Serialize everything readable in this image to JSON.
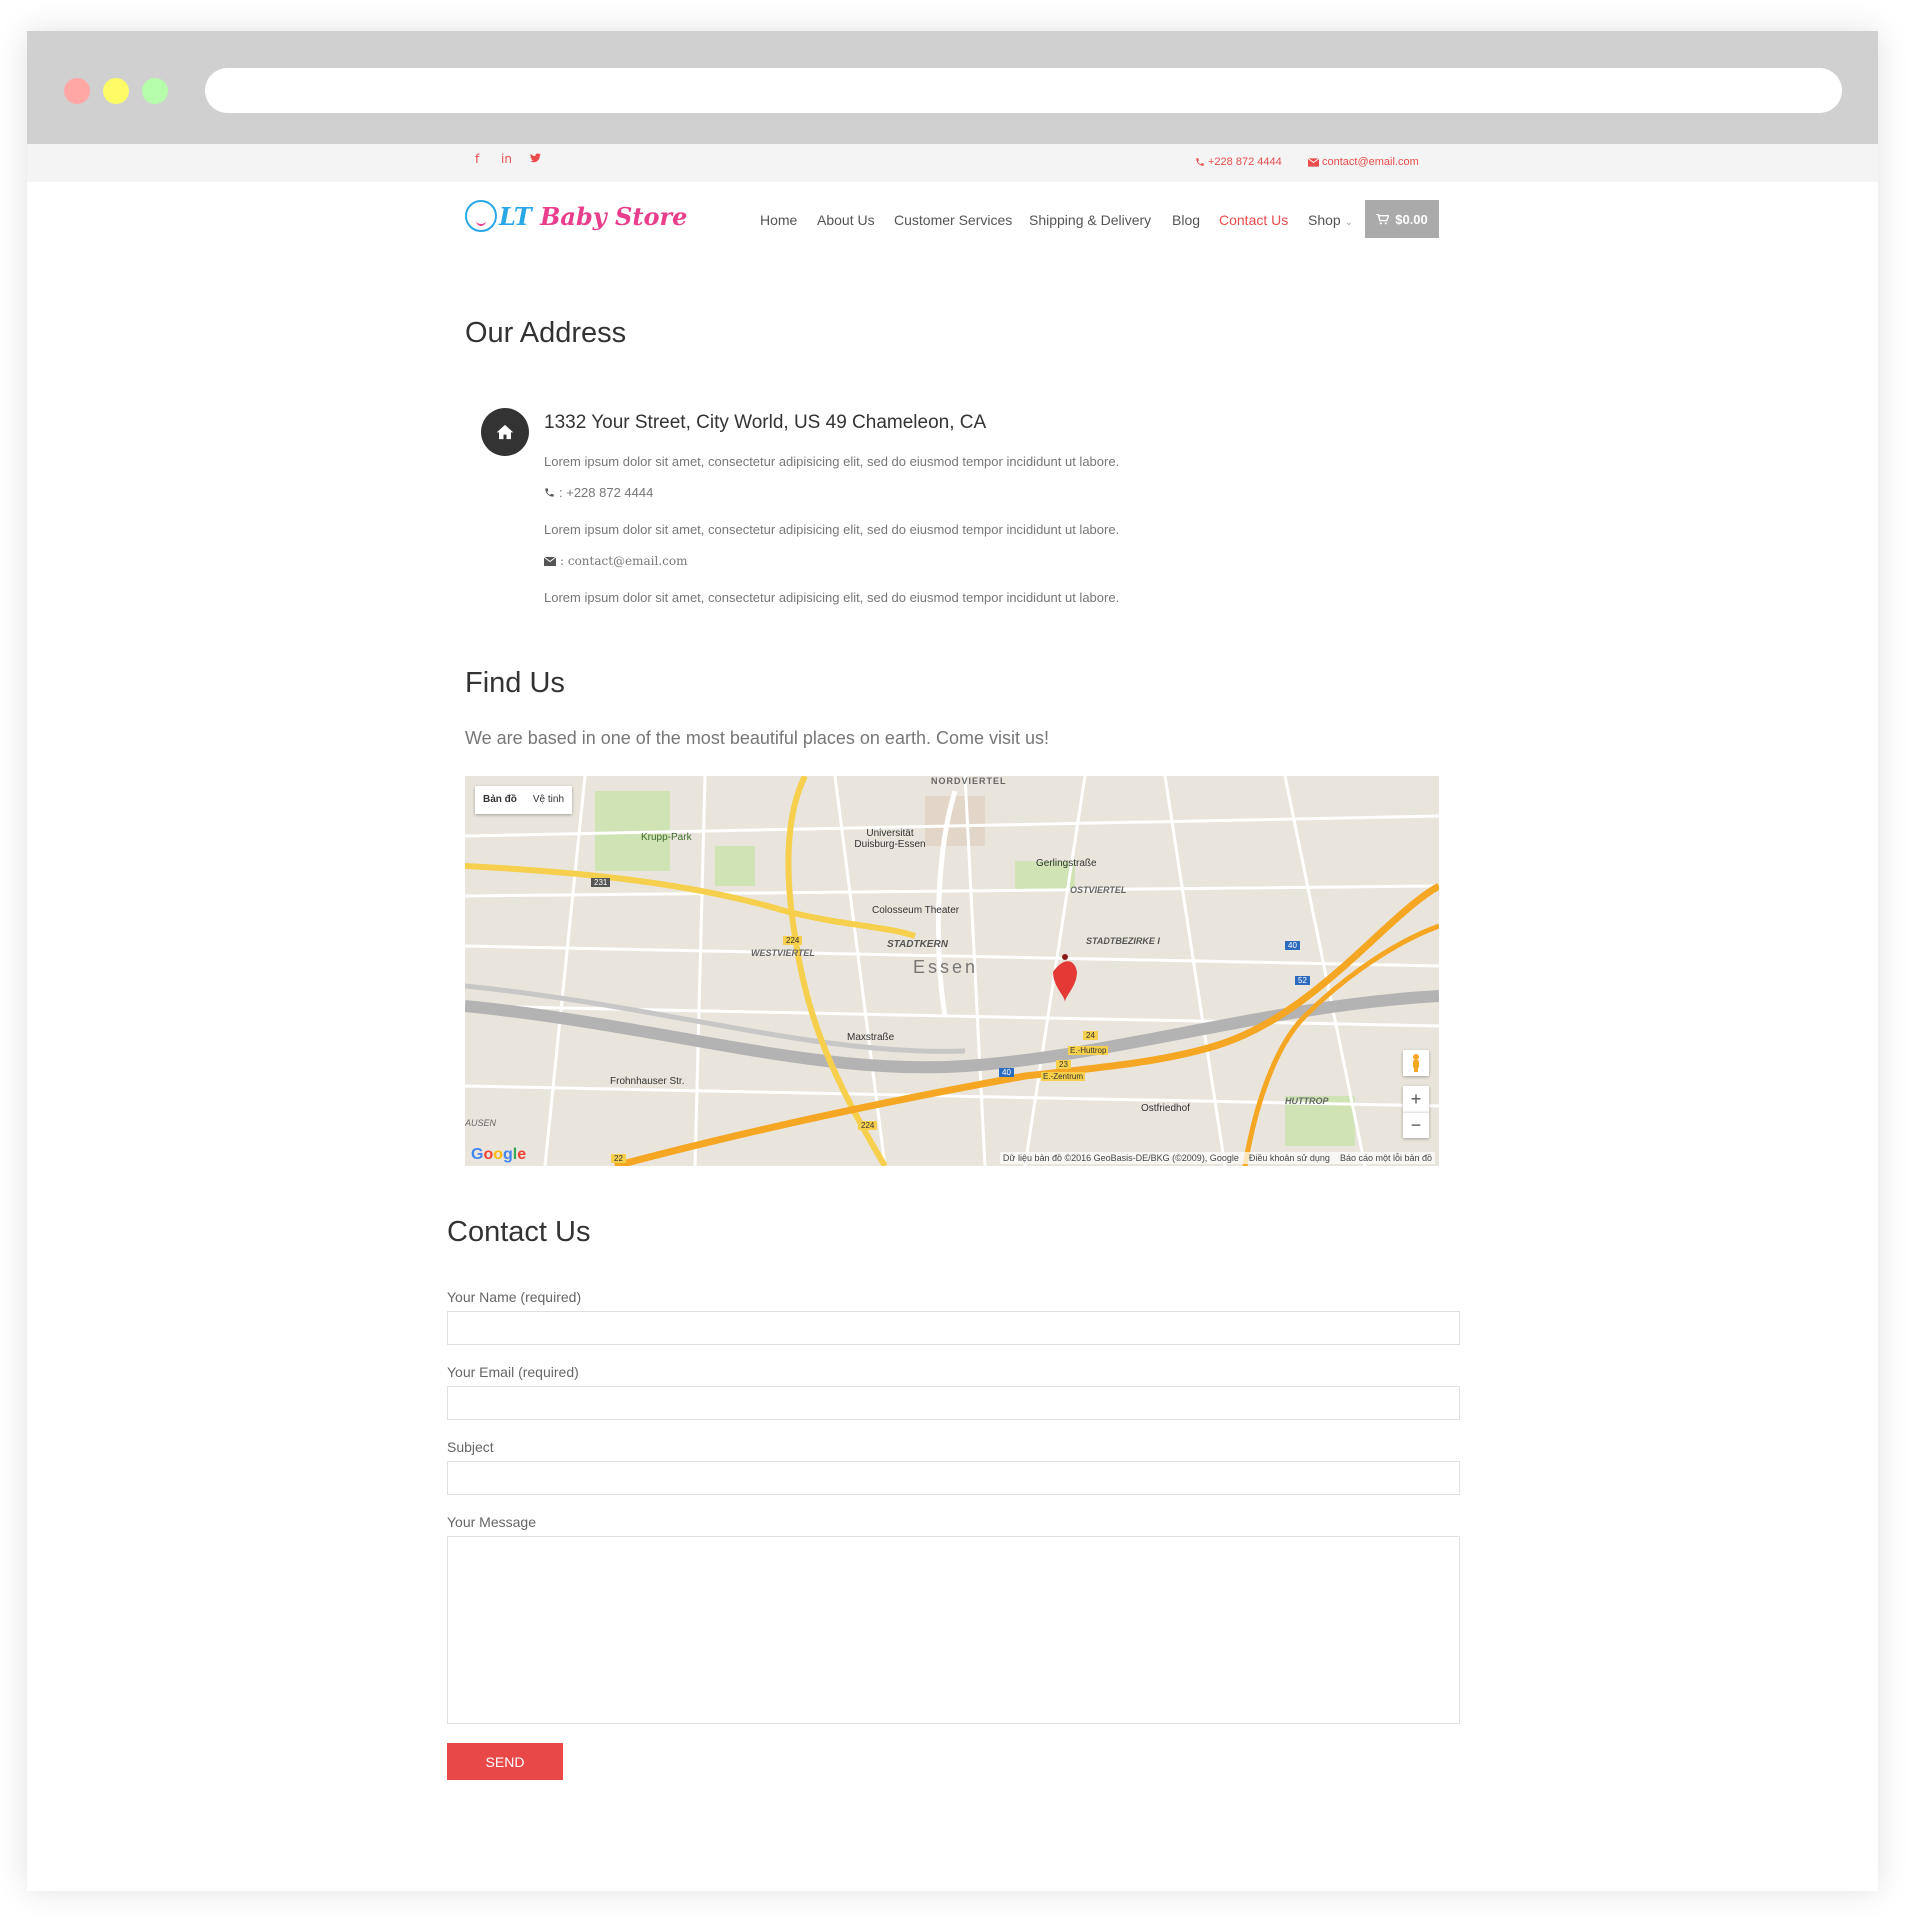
{
  "topbar": {
    "social": [
      "f",
      "in",
      "t"
    ],
    "phone": "+228 872 4444",
    "email": "contact@email.com"
  },
  "logo": {
    "part1": "LT",
    "part2": "Baby Store"
  },
  "nav": {
    "items": [
      "Home",
      "About Us",
      "Customer Services",
      "Shipping & Delivery",
      "Blog",
      "Contact Us",
      "Shop"
    ],
    "active": "Contact Us",
    "cart_total": "$0.00"
  },
  "address": {
    "heading": "Our Address",
    "street": "1332 Your Street, City World, US 49 Chameleon, CA",
    "lorem": "Lorem ipsum dolor sit amet, consectetur adipisicing elit, sed do eiusmod tempor incididunt ut labore.",
    "phone_line": ": +228 872 4444",
    "email_line": ": contact@email.com"
  },
  "find_us": {
    "heading": "Find Us",
    "subtitle": "We are based in one of the most beautiful places on earth. Come visit us!"
  },
  "map": {
    "toggle_map": "Bản đồ",
    "toggle_satellite": "Vệ tinh",
    "labels": [
      "NORDVIERTEL",
      "Krupp-Park",
      "Universität Duisburg-Essen",
      "Gerlingstraße",
      "OSTVIERTEL",
      "Colosseum Theater",
      "STADTKERN",
      "Essen",
      "WESTVIERTEL",
      "STADTBEZIRKE I",
      "Maxstraße",
      "Frohnhauser Str.",
      "HUTTROP",
      "Ostfriedhof",
      "AUSEN",
      "E.-Huttrop",
      "E.-Zentrum"
    ],
    "road_numbers": [
      "231",
      "224",
      "40",
      "52",
      "24",
      "23",
      "40",
      "224",
      "22"
    ],
    "footer_data": "Dữ liệu bản đồ ©2016 GeoBasis-DE/BKG (©2009), Google",
    "footer_terms": "Điều khoản sử dụng",
    "footer_report": "Báo cáo một lỗi bản đồ",
    "google": "Google",
    "zoom_in": "+",
    "zoom_out": "−",
    "colors": {
      "road_major": "#f5a623",
      "road_yellow": "#f6cf4c",
      "park": "#cfe3b5",
      "base": "#e9e5dc",
      "rail": "#b3b3b3",
      "marker": "#e53935"
    }
  },
  "contact": {
    "heading": "Contact Us",
    "name_label": "Your Name (required)",
    "email_label": "Your Email (required)",
    "subject_label": "Subject",
    "message_label": "Your Message",
    "send": "SEND"
  },
  "colors": {
    "accent": "#e84c4c",
    "send": "#e84848",
    "cart": "#aaaaaa"
  }
}
